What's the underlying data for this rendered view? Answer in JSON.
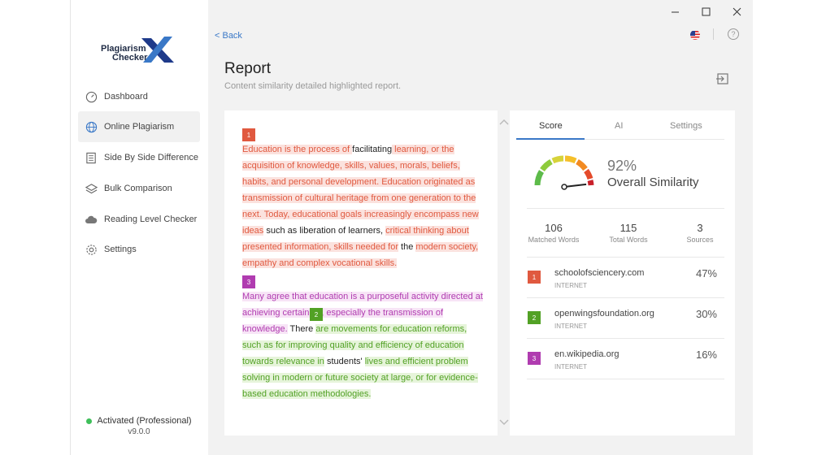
{
  "window": {
    "minimize": "—",
    "maximize": "☐",
    "close": "✕"
  },
  "logo": {
    "line1": "Plagiarism",
    "line2": "Checker",
    "mark": "X"
  },
  "nav": [
    {
      "label": "Dashboard",
      "icon": "dashboard-icon"
    },
    {
      "label": "Online Plagiarism",
      "icon": "globe-icon"
    },
    {
      "label": "Side By Side Difference",
      "icon": "compare-icon"
    },
    {
      "label": "Bulk Comparison",
      "icon": "layers-icon"
    },
    {
      "label": "Reading Level Checker",
      "icon": "cloud-icon"
    },
    {
      "label": "Settings",
      "icon": "gear-icon"
    }
  ],
  "status": {
    "text": "Activated (Professional)",
    "version": "v9.0.0",
    "color": "#3fbf5a"
  },
  "header": {
    "back": "< Back",
    "title": "Report",
    "subtitle": "Content similarity detailed highlighted report."
  },
  "document": {
    "badges": [
      "1",
      "3",
      "2"
    ],
    "paragraph1": [
      {
        "t": "Education is the process of ",
        "c": "red"
      },
      {
        "t": "facilitating",
        "c": "plain"
      },
      {
        "t": " learning, or the acquisition of knowledge, skills, values, morals, beliefs, habits, and personal development. Education originated as transmission of cultural heritage from one generation to the next. Today, educational goals increasingly encompass new ideas",
        "c": "red"
      },
      {
        "t": " such as liberation of learners, ",
        "c": "plain"
      },
      {
        "t": "critical thinking about presented information, skills needed for",
        "c": "red"
      },
      {
        "t": " the ",
        "c": "plain"
      },
      {
        "t": "modern society, empathy and complex vocational skills.",
        "c": "red"
      }
    ],
    "paragraph2": [
      {
        "t": "Many agree that education is a purposeful activity directed at achieving certain a",
        "c": "purple"
      },
      {
        "t": "s, especially the transmission of knowledge.",
        "c": "purple"
      },
      {
        "t": " There ",
        "c": "plain"
      },
      {
        "t": "are movements for education reforms, such as for improving quality and efficiency of education towards relevance in",
        "c": "green"
      },
      {
        "t": " students' ",
        "c": "plain"
      },
      {
        "t": "lives and efficient problem solving in modern or future society at large, or for evidence-based education methodologies.",
        "c": "green"
      }
    ]
  },
  "panel": {
    "tabs": [
      "Score",
      "AI",
      "Settings"
    ],
    "score": {
      "percent": "92%",
      "label": "Overall Similarity",
      "value": 0.92
    },
    "stats": [
      {
        "num": "106",
        "label": "Matched Words"
      },
      {
        "num": "115",
        "label": "Total Words"
      },
      {
        "num": "3",
        "label": "Sources"
      }
    ],
    "sources": [
      {
        "badge": "1",
        "name": "schoolofsciencery.com",
        "type": "INTERNET",
        "pct": "47%",
        "color": "#e0593f"
      },
      {
        "badge": "2",
        "name": "openwingsfoundation.org",
        "type": "INTERNET",
        "pct": "30%",
        "color": "#52a125"
      },
      {
        "badge": "3",
        "name": "en.wikipedia.org",
        "type": "INTERNET",
        "pct": "16%",
        "color": "#b03cb0"
      }
    ]
  },
  "colors": {
    "accent": "#3a78c7",
    "red": "#e0593f",
    "green": "#52a125",
    "purple": "#b03cb0"
  }
}
